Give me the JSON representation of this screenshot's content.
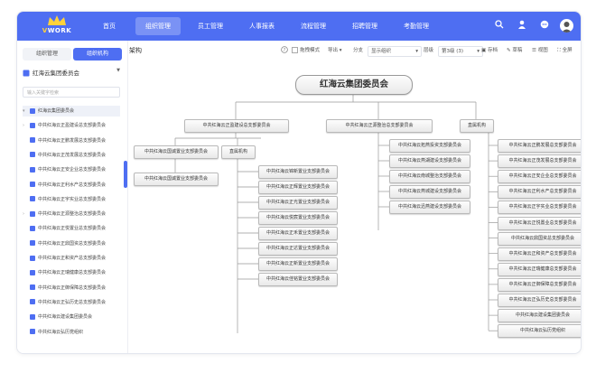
{
  "app": {
    "logo_text": "WORK",
    "logo_prefix": "V"
  },
  "topnav": [
    {
      "label": "首页",
      "active": false
    },
    {
      "label": "组织管理",
      "active": true
    },
    {
      "label": "员工管理",
      "active": false
    },
    {
      "label": "人事报表",
      "active": false
    },
    {
      "label": "流程管理",
      "active": false
    },
    {
      "label": "招聘管理",
      "active": false
    },
    {
      "label": "考勤管理",
      "active": false
    }
  ],
  "sidebar": {
    "tabs": [
      "组织管理",
      "组织机构"
    ],
    "org_select": "红海云集团委员会",
    "search_placeholder": "输入关键字检索",
    "tree": [
      {
        "label": "红海云集团委员会",
        "arrow": "▾",
        "root": true
      },
      {
        "label": "中共红海云正盈建设总支部委员会",
        "arrow": "›"
      },
      {
        "label": "中共红海云正鹏发展总支部委员会",
        "arrow": ""
      },
      {
        "label": "中共红海云正茂发展总支部委员会",
        "arrow": ""
      },
      {
        "label": "中共红海云正安企业总支部委员会",
        "arrow": ""
      },
      {
        "label": "中共红海云正利水产总支部委员会",
        "arrow": ""
      },
      {
        "label": "中共红海云正宇实业总支部委员会",
        "arrow": ""
      },
      {
        "label": "中共红海云正源整治总支部委员会",
        "arrow": "›"
      },
      {
        "label": "中共红海云正悦置业总支部委员会",
        "arrow": ""
      },
      {
        "label": "中共红海云正鼎国资总支部委员会",
        "arrow": ""
      },
      {
        "label": "中共红海云正和资产总支部委员会",
        "arrow": ""
      },
      {
        "label": "中共红海云正瑞健康总支部委员会",
        "arrow": ""
      },
      {
        "label": "中共红海云正御保障总支部委员会",
        "arrow": ""
      },
      {
        "label": "中共红海云正弘历史总支部委员会",
        "arrow": ""
      },
      {
        "label": "中共红海云建设集团委员会",
        "arrow": ""
      },
      {
        "label": "中共红海云弘历党组织",
        "arrow": ""
      }
    ]
  },
  "toolbar": {
    "title": "架构",
    "items": [
      "拖拽模式",
      "导出",
      "分支",
      "显示组织",
      "层级",
      "第3级 (3)",
      "存档",
      "草稿",
      "视图",
      "全屏"
    ]
  },
  "org": {
    "root": "红海云集团委员会",
    "level1": [
      "中共红海云正盈建设总支部委员会",
      "中共红海云正源整治总支部委员会",
      "直属机构"
    ],
    "branch_a": [
      "中共红海云国诚置业支部委员会",
      "直属机构"
    ],
    "branch_a_left_child": [
      "中共红海云国诚置业支部委员会"
    ],
    "branch_a_direct": [
      "中共红海云锦新置业支部委员会",
      "中共红海云正辉置业支部委员会",
      "中共红海云正光置业支部委员会",
      "中共红海云悦宸置业支部委员会",
      "中共红海云正禾置业支部委员会",
      "中共红海云正达置业支部委员会",
      "中共红海云正新置业支部委员会",
      "中共红海云佳铭置业支部委员会"
    ],
    "branch_b": [
      "中共红海云拓燕投资支部委员会",
      "中共红海云燕湖建设支部委员会",
      "中共红海云南城整治支部委员会",
      "中共红海云燕城建设支部委员会",
      "中共红海云迅燕建设支部委员会"
    ],
    "branch_c": [
      "中共红海云正鹏发展总支部委员会",
      "中共红海云正茂发展总支部委员会",
      "中共红海云正安企业总支部委员会",
      "中共红海云正利水产总支部委员会",
      "中共红海云正宇实业总支部委员会",
      "中共红海云正悦置业总支部委员会",
      "中共红海云鼎国资总支部委员会",
      "中共红海云正和资产总支部委员会",
      "中共红海云正瑞健康总支部委员会",
      "中共红海云正御保障总支部委员会",
      "中共红海云正弘历史总支部委员会",
      "中共红海云建设集团委员会",
      "中共红海云弘历党组织"
    ]
  }
}
